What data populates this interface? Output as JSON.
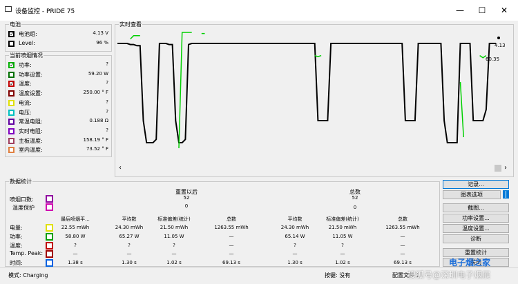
{
  "window": {
    "title": "设备监控 - PRIDE 75",
    "minimize": "—",
    "maximize": "☐",
    "close": "✕"
  },
  "battery": {
    "group_label": "电池",
    "rows": [
      {
        "label": "电池组:",
        "value": "4.13 V",
        "color": "#000000",
        "checked": true
      },
      {
        "label": "Level:",
        "value": "96 %",
        "color": "#000000",
        "checked": false
      }
    ]
  },
  "current_status": {
    "group_label": "当前喷烟情况",
    "rows": [
      {
        "label": "功率:",
        "value": "?",
        "color": "#00b000",
        "checked": true
      },
      {
        "label": "功率设置:",
        "value": "59.20 W",
        "color": "#007000",
        "checked": false
      },
      {
        "label": "温度:",
        "value": "?",
        "color": "#c00000",
        "checked": true
      },
      {
        "label": "温度设置:",
        "value": "250.00 ° F",
        "color": "#800000",
        "checked": false
      },
      {
        "label": "电流:",
        "value": "?",
        "color": "#e0e000",
        "checked": false
      },
      {
        "label": "电压:",
        "value": "?",
        "color": "#00c0c0",
        "checked": false
      },
      {
        "label": "常温电阻:",
        "value": "0.188 Ω",
        "color": "#6000a0",
        "checked": false
      },
      {
        "label": "实时电阻:",
        "value": "?",
        "color": "#8000c0",
        "checked": false
      },
      {
        "label": "主板温度:",
        "value": "158.19 ° F",
        "color": "#a04060",
        "checked": false
      },
      {
        "label": "室内温度:",
        "value": "73.52 ° F",
        "color": "#e08040",
        "checked": false
      }
    ]
  },
  "realtime": {
    "group_label": "实时查看",
    "readout_top": "4.13",
    "readout_second": "60.35",
    "scroll_left": "‹",
    "scroll_right": "›"
  },
  "chart_data": {
    "type": "line",
    "title": "",
    "xlabel": "",
    "ylabel": "",
    "series": [
      {
        "color": "#000000",
        "values": [
          0.95,
          0.95,
          0.95,
          0.95,
          0.94,
          0.94,
          0.93,
          0.93,
          0.25,
          0.05,
          0.05,
          0.05,
          0.08,
          0.95,
          0.95,
          0.95,
          0.94,
          0.94,
          0.25,
          0.05,
          0.05,
          0.08,
          0.94,
          0.95,
          0.95,
          0.95,
          0.95,
          0.95,
          0.95,
          0.95,
          0.95,
          0.95,
          0.95,
          0.95,
          0.95,
          0.95,
          0.95,
          0.95,
          0.95,
          0.95,
          0.95,
          0.95,
          0.95,
          0.95,
          0.95,
          0.95,
          0.95,
          0.95,
          0.95,
          0.95,
          0.95,
          0.95,
          0.95,
          0.95,
          0.95,
          0.95,
          0.95,
          0.95,
          0.95,
          0.95,
          0.95,
          0.95,
          0.25,
          0.25,
          0.25,
          0.25,
          0.95,
          0.95,
          0.95,
          0.95,
          0.95,
          0.95,
          0.95,
          0.95,
          0.95,
          0.95,
          0.95,
          0.95,
          0.95,
          0.95,
          0.95,
          0.95,
          0.95,
          0.95,
          0.95,
          0.95,
          0.95,
          0.95,
          0.95,
          0.25,
          0.25,
          0.25,
          0.25,
          0.95,
          0.95,
          0.95,
          0.95,
          0.95,
          0.95,
          0.95,
          0.95,
          0.25,
          0.05,
          0.05,
          0.05,
          0.05,
          0.95,
          0.95,
          0.95,
          0.95,
          0.25,
          0.25,
          0.25,
          0.25,
          0.35,
          0.95,
          0.95,
          0.95
        ]
      },
      {
        "color": "#00d000",
        "values": [
          null,
          null,
          null,
          null,
          0.99,
          1.02,
          1.02,
          1.02,
          null,
          null,
          null,
          null,
          null,
          null,
          null,
          null,
          null,
          null,
          null,
          0.0,
          1.05,
          1.05,
          1.05,
          1.05,
          null,
          null,
          1.04,
          1.04,
          null,
          null,
          null,
          null,
          null,
          null,
          null,
          null,
          null,
          null,
          null,
          null,
          null,
          null,
          null,
          null,
          null,
          null,
          null,
          null,
          null,
          null,
          null,
          null,
          null,
          null,
          null,
          null,
          null,
          null,
          null,
          null,
          null,
          0.84,
          0.83,
          0.84,
          null,
          null,
          null,
          null,
          null,
          null,
          null,
          null,
          null,
          null,
          null,
          null,
          null,
          null,
          null,
          null,
          null,
          null,
          null,
          null,
          null,
          null,
          null,
          null,
          null,
          null,
          null,
          0.83,
          null,
          null,
          null,
          null,
          null,
          null,
          null,
          null,
          null,
          null,
          null,
          null,
          null,
          null,
          0.6,
          0.1,
          null,
          null,
          null,
          null,
          0.84,
          0.82,
          0.84,
          null,
          null,
          null,
          null,
          null,
          null,
          null,
          null,
          null,
          null,
          null,
          null,
          0.25,
          null,
          null,
          null
        ]
      }
    ]
  },
  "stats": {
    "group_label": "数据统计",
    "puff_count_label": "喷烟口数:",
    "temp_protect_label": "温度保护",
    "reset_title": "重置以后",
    "reset_count": "52",
    "reset_protect": "0",
    "total_title": "总数",
    "total_count": "52",
    "total_protect": "0",
    "headers": [
      "最后喷烟平...",
      "平均数",
      "标准偏差(统计)",
      "总数",
      "平均数",
      "标准偏差(统计)",
      "总数"
    ],
    "rows": [
      {
        "label": "电量:",
        "color": "#e0e000",
        "cells": [
          "22.55 mWh",
          "24.30 mWh",
          "21.50 mWh",
          "1263.55 mWh",
          "24.30 mWh",
          "21.50 mWh",
          "1263.55 mWh"
        ]
      },
      {
        "label": "功率:",
        "color": "#00a000",
        "cells": [
          "58.80 W",
          "65.27 W",
          "11.05 W",
          "—",
          "65.14 W",
          "11.05 W",
          "—"
        ]
      },
      {
        "label": "温度:",
        "color": "#c00000",
        "cells": [
          "?",
          "?",
          "?",
          "—",
          "?",
          "?",
          "—"
        ]
      },
      {
        "label": "Temp. Peak:",
        "color": "#a00000",
        "cells": [
          "—",
          "—",
          "—",
          "—",
          "—",
          "—",
          "—"
        ]
      },
      {
        "label": "时间:",
        "color": "#0060e0",
        "cells": [
          "1.38 s",
          "1.30 s",
          "1.02 s",
          "69.13 s",
          "1.30 s",
          "1.02 s",
          "69.13 s"
        ]
      }
    ]
  },
  "buttons": {
    "record": "记录...",
    "chart_options": "图表选项",
    "screenshot": "截图...",
    "power_settings": "功率设置...",
    "temp_settings": "温度设置...",
    "diagnose": "诊断",
    "reset_stats": "重置统计",
    "close": "关闭"
  },
  "statusbar": {
    "mode": "模式: Charging",
    "buttons_label": "按键: 没有",
    "profile": "配置文件 1",
    "watermark": "搜狐号@深圳电子烟展",
    "site": "电子烟之家"
  }
}
